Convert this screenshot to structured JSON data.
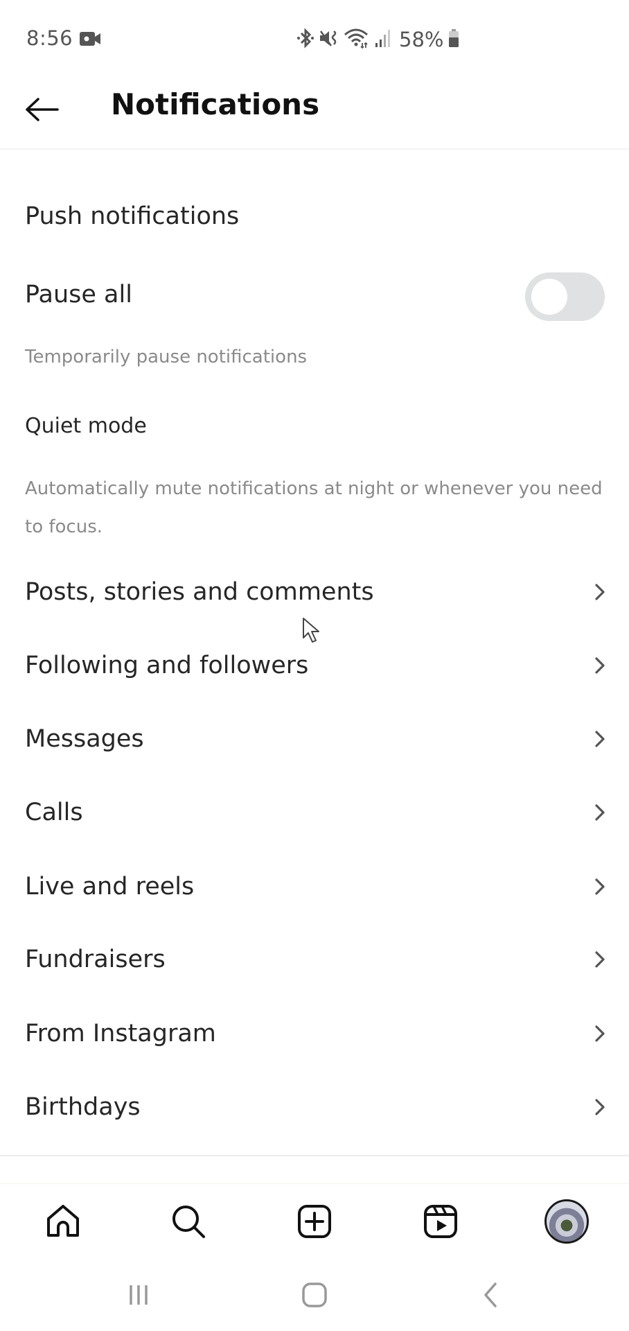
{
  "status_bar": {
    "time": "8:56",
    "battery_percent": "58%",
    "icons": [
      "video-recording-icon",
      "bluetooth-icon",
      "mute-vibrate-icon",
      "wifi-icon",
      "signal-icon",
      "battery-icon"
    ]
  },
  "header": {
    "back_icon": "arrow-left-icon",
    "title": "Notifications"
  },
  "push": {
    "section_title": "Push notifications",
    "pause_all": {
      "label": "Pause all",
      "enabled": false,
      "description": "Temporarily pause notifications"
    },
    "quiet_mode": {
      "label": "Quiet mode",
      "description": "Automatically mute notifications at night or whenever you need to focus."
    }
  },
  "categories": [
    {
      "label": "Posts, stories and comments"
    },
    {
      "label": "Following and followers"
    },
    {
      "label": "Messages"
    },
    {
      "label": "Calls"
    },
    {
      "label": "Live and reels"
    },
    {
      "label": "Fundraisers"
    },
    {
      "label": "From Instagram"
    },
    {
      "label": "Birthdays"
    }
  ],
  "bottom_nav": {
    "items": [
      "home-icon",
      "search-icon",
      "create-icon",
      "reels-icon",
      "profile-avatar"
    ]
  },
  "system_nav": {
    "items": [
      "recents-icon",
      "home-button-icon",
      "back-icon"
    ]
  }
}
